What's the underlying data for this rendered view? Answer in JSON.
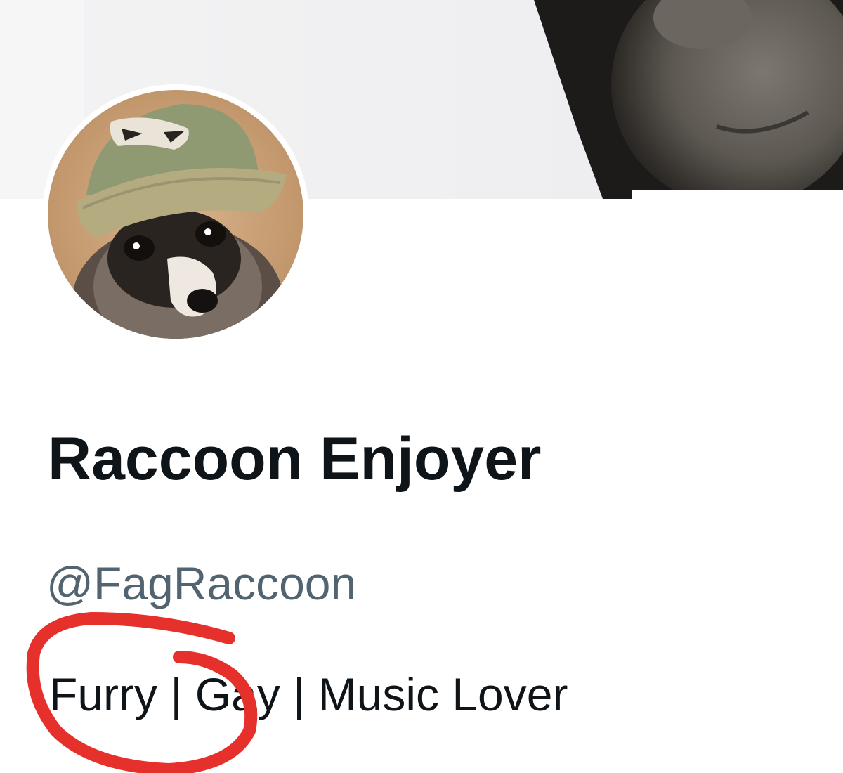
{
  "profile": {
    "display_name": "Raccoon Enjoyer",
    "handle": "@FagRaccoon",
    "bio": "Furry | Gay | Music Lover",
    "avatar_icon": "raccoon-avatar",
    "banner_icon": "header-banner"
  },
  "colors": {
    "name_text": "#0f1419",
    "handle_text": "#536471",
    "annotation_stroke": "#e5302c",
    "background": "#ffffff"
  }
}
